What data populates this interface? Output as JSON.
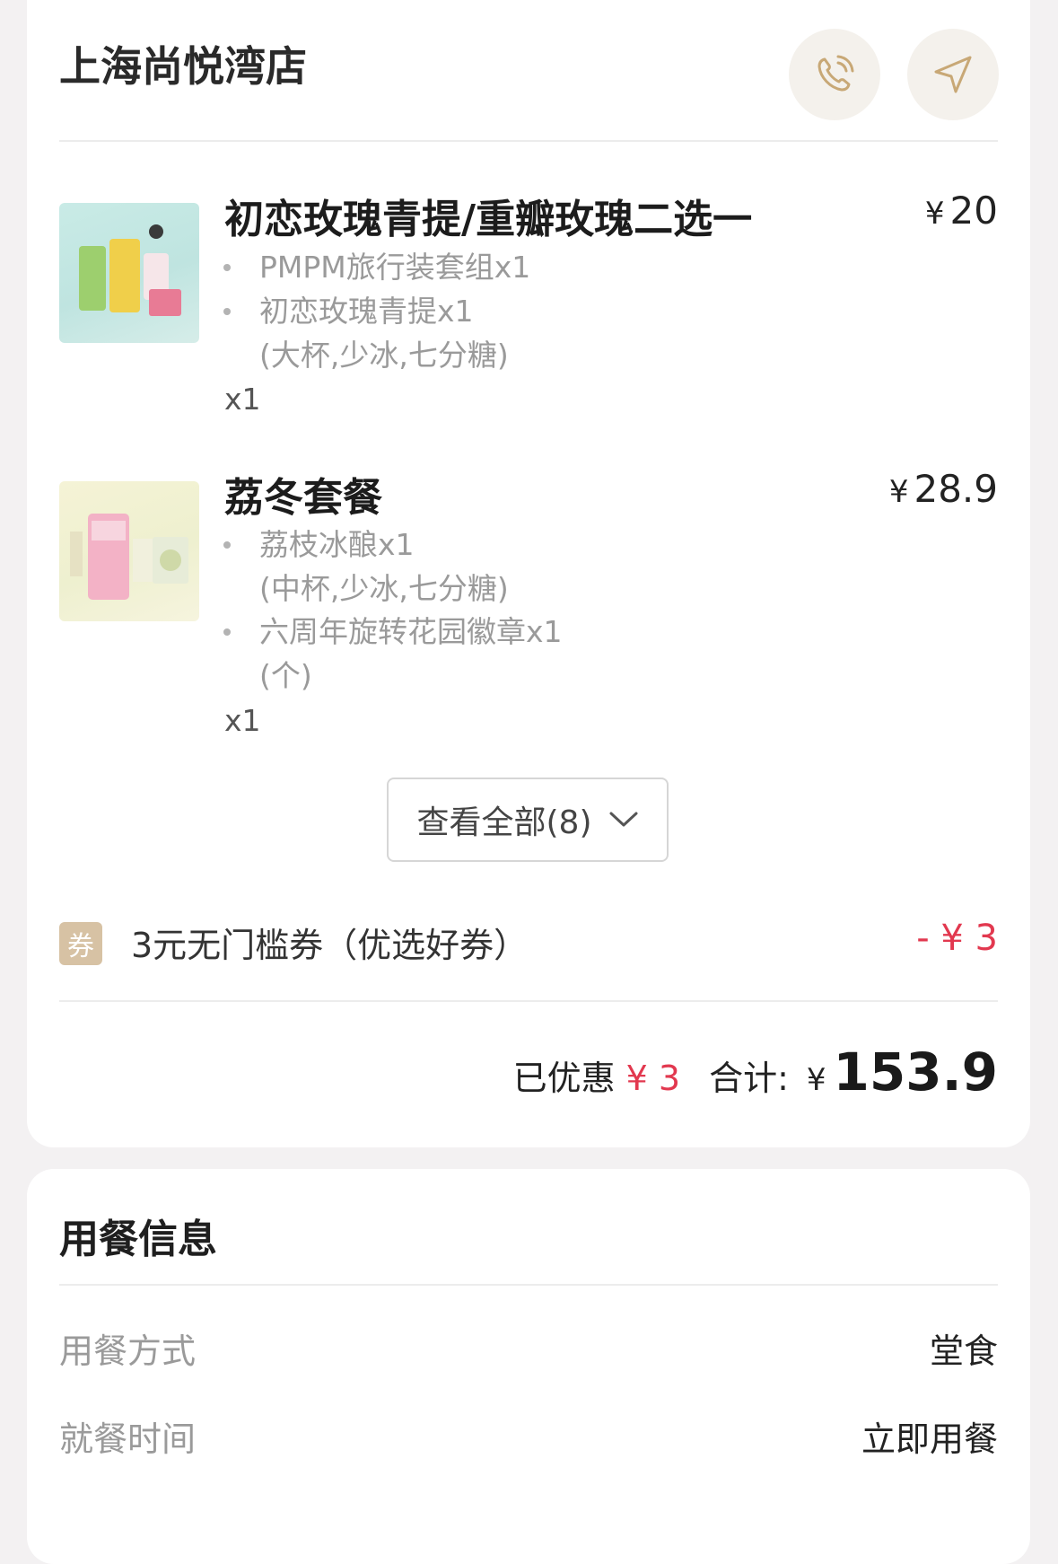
{
  "store": {
    "name": "上海尚悦湾店"
  },
  "items": [
    {
      "title": "初恋玫瑰青提/重瓣玫瑰二选一",
      "currency": "¥",
      "price": "20",
      "sub_lines": [
        "PMPM旅行装套组x1",
        "初恋玫瑰青提x1",
        "(大杯,少冰,七分糖)"
      ],
      "qty": "x1"
    },
    {
      "title": "荔冬套餐",
      "currency": "¥",
      "price": "28.9",
      "sub_lines": [
        "荔枝冰酿x1",
        "(中杯,少冰,七分糖)",
        "六周年旋转花园徽章x1",
        "(个)"
      ],
      "qty": "x1"
    }
  ],
  "view_all": {
    "label": "查看全部(8)"
  },
  "coupon": {
    "badge": "券",
    "text": "3元无门槛券（优选好券）",
    "amount": "- ¥ 3"
  },
  "summary": {
    "discount_label": "已优惠",
    "discount_value": "¥ 3",
    "total_label": "合计:",
    "total_currency": "¥",
    "total_value": "153.9"
  },
  "dining": {
    "title": "用餐信息",
    "rows": [
      {
        "label": "用餐方式",
        "value": "堂食"
      },
      {
        "label": "就餐时间",
        "value": "立即用餐"
      }
    ]
  },
  "colors": {
    "accent_red": "#e2384f",
    "coupon_gold": "#d7c2a4",
    "icon_gold": "#c8a876"
  },
  "icons": {
    "phone": "phone-call-icon",
    "navigate": "navigation-arrow-icon",
    "chevron": "chevron-down-icon"
  }
}
